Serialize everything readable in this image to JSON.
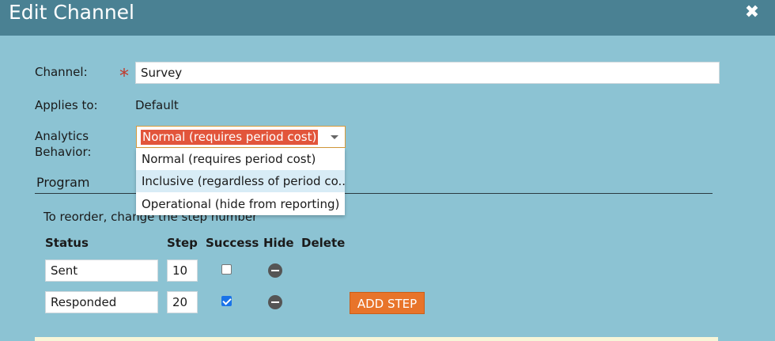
{
  "window": {
    "title": "Edit Channel",
    "close_label": "✖"
  },
  "form": {
    "channel_label": "Channel:",
    "required_mark": "*",
    "channel_value": "Survey",
    "applies_label": "Applies to:",
    "applies_value": "Default",
    "analytics_label_line1": "Analytics",
    "analytics_label_line2": "Behavior:",
    "analytics_selected": "Normal (requires period cost)",
    "analytics_options": [
      "Normal (requires period cost)",
      "Inclusive (regardless of period co...",
      "Operational (hide from reporting)"
    ]
  },
  "program": {
    "section_title": "Program",
    "reorder_hint": "To reorder, change the step number",
    "columns": [
      "Status",
      "Step",
      "Success",
      "Hide",
      "Delete"
    ],
    "rows": [
      {
        "status": "Sent",
        "step": "10",
        "success": false
      },
      {
        "status": "Responded",
        "step": "20",
        "success": true
      }
    ],
    "add_step_label": "ADD STEP"
  }
}
